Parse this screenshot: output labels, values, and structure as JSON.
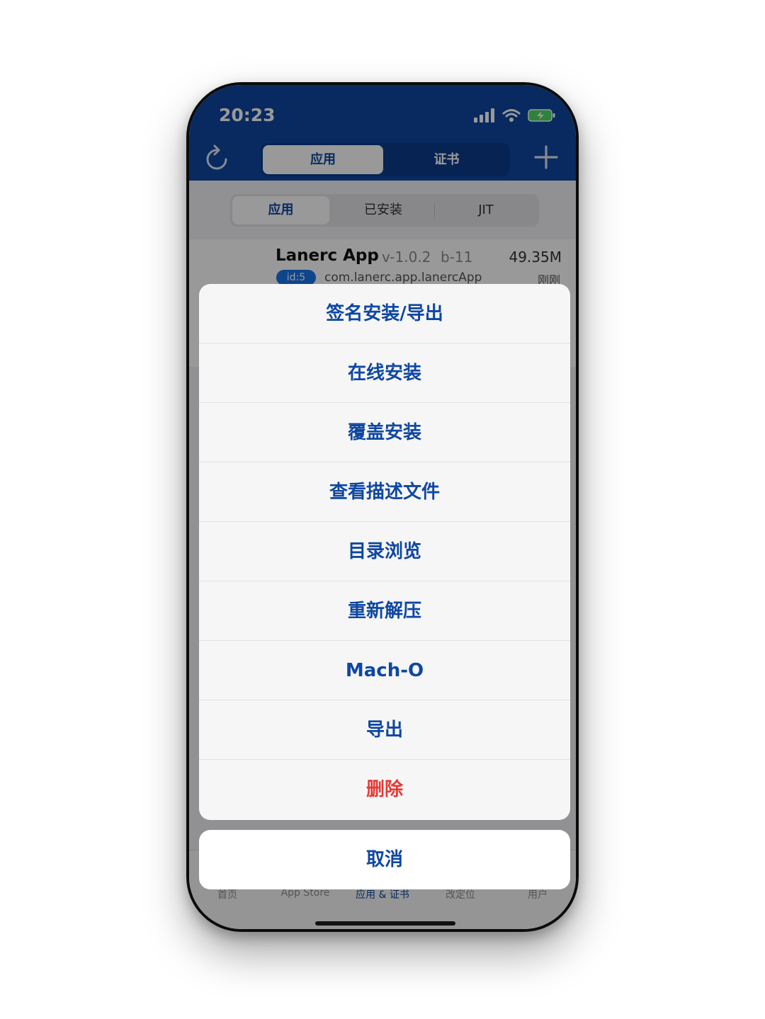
{
  "status_bar": {
    "time": "20:23"
  },
  "header": {
    "tabs": [
      {
        "label": "应用",
        "selected": true
      },
      {
        "label": "证书",
        "selected": false
      }
    ],
    "refresh_icon": "refresh-icon",
    "add_icon": "plus-icon",
    "color": "#0e47a1"
  },
  "sub_tabs": [
    {
      "label": "应用",
      "selected": true
    },
    {
      "label": "已安装",
      "selected": false
    },
    {
      "label": "JIT",
      "selected": false
    }
  ],
  "app": {
    "name": "Lanerc App",
    "version": "v-1.0.2",
    "build": "b-11",
    "size": "49.35M",
    "id": "id:5",
    "bundle": "com.lanerc.app.lanercApp",
    "time": "刚刚"
  },
  "action_sheet": {
    "actions": [
      {
        "label": "签名安装/导出",
        "destructive": false
      },
      {
        "label": "在线安装",
        "destructive": false
      },
      {
        "label": "覆盖安装",
        "destructive": false
      },
      {
        "label": "查看描述文件",
        "destructive": false
      },
      {
        "label": "目录浏览",
        "destructive": false
      },
      {
        "label": "重新解压",
        "destructive": false
      },
      {
        "label": "Mach-O",
        "destructive": false
      },
      {
        "label": "导出",
        "destructive": false
      },
      {
        "label": "删除",
        "destructive": true
      }
    ],
    "cancel": "取消"
  },
  "tab_bar": [
    {
      "label": "首页",
      "active": false
    },
    {
      "label": "App Store",
      "active": false
    },
    {
      "label": "应用 & 证书",
      "active": true
    },
    {
      "label": "改定位",
      "active": false
    },
    {
      "label": "用户",
      "active": false
    }
  ]
}
